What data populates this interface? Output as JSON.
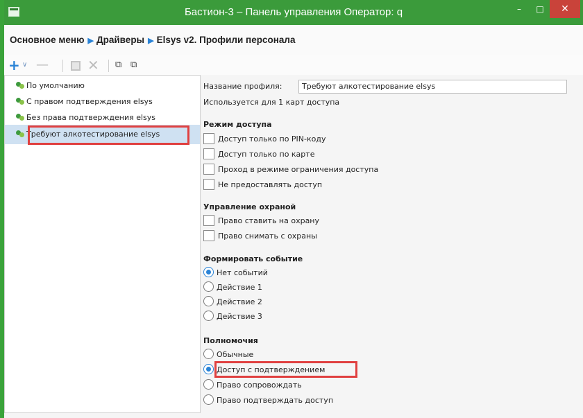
{
  "window": {
    "title": "Бастион-3 – Панель управления Оператор: q",
    "min_icon": "–",
    "max_icon": "□",
    "close_icon": "✕"
  },
  "breadcrumbs": [
    "Основное меню",
    "Драйверы",
    "Elsys v2. Профили персонала"
  ],
  "toolbar": {
    "add": "+",
    "dropdown": "∨",
    "remove": "—",
    "delete": "✕",
    "copy1": "⧉",
    "copy2": "⧉"
  },
  "profiles": [
    {
      "label": "По умолчанию"
    },
    {
      "label": "С правом подтверждения elsys"
    },
    {
      "label": "Без права подтверждения elsys"
    },
    {
      "label": "Требуют алкотестирование elsys",
      "selected": true
    }
  ],
  "details": {
    "name_label": "Название профиля:",
    "name_value": "Требуют алкотестирование elsys",
    "usage": "Используется для 1 карт доступа",
    "access_mode": {
      "title": "Режим доступа",
      "options": [
        "Доступ только по PIN-коду",
        "Доступ только по карте",
        "Проход в режиме ограничения доступа",
        "Не предоставлять доступ"
      ]
    },
    "guard": {
      "title": "Управление охраной",
      "options": [
        "Право ставить на охрану",
        "Право снимать с охраны"
      ]
    },
    "event": {
      "title": "Формировать событие",
      "options": [
        "Нет событий",
        "Действие 1",
        "Действие 2",
        "Действие 3"
      ],
      "selected": "Нет событий"
    },
    "powers": {
      "title": "Полномочия",
      "options": [
        "Обычные",
        "Доступ с подтверждением",
        "Право сопровождать",
        "Право подтверждать доступ"
      ],
      "selected": "Доступ с подтверждением"
    }
  },
  "colors": {
    "titlebar": "#3b9b3b",
    "accent": "#2a83d6",
    "highlight": "#e04040",
    "selected_row": "#cfe1f2"
  }
}
